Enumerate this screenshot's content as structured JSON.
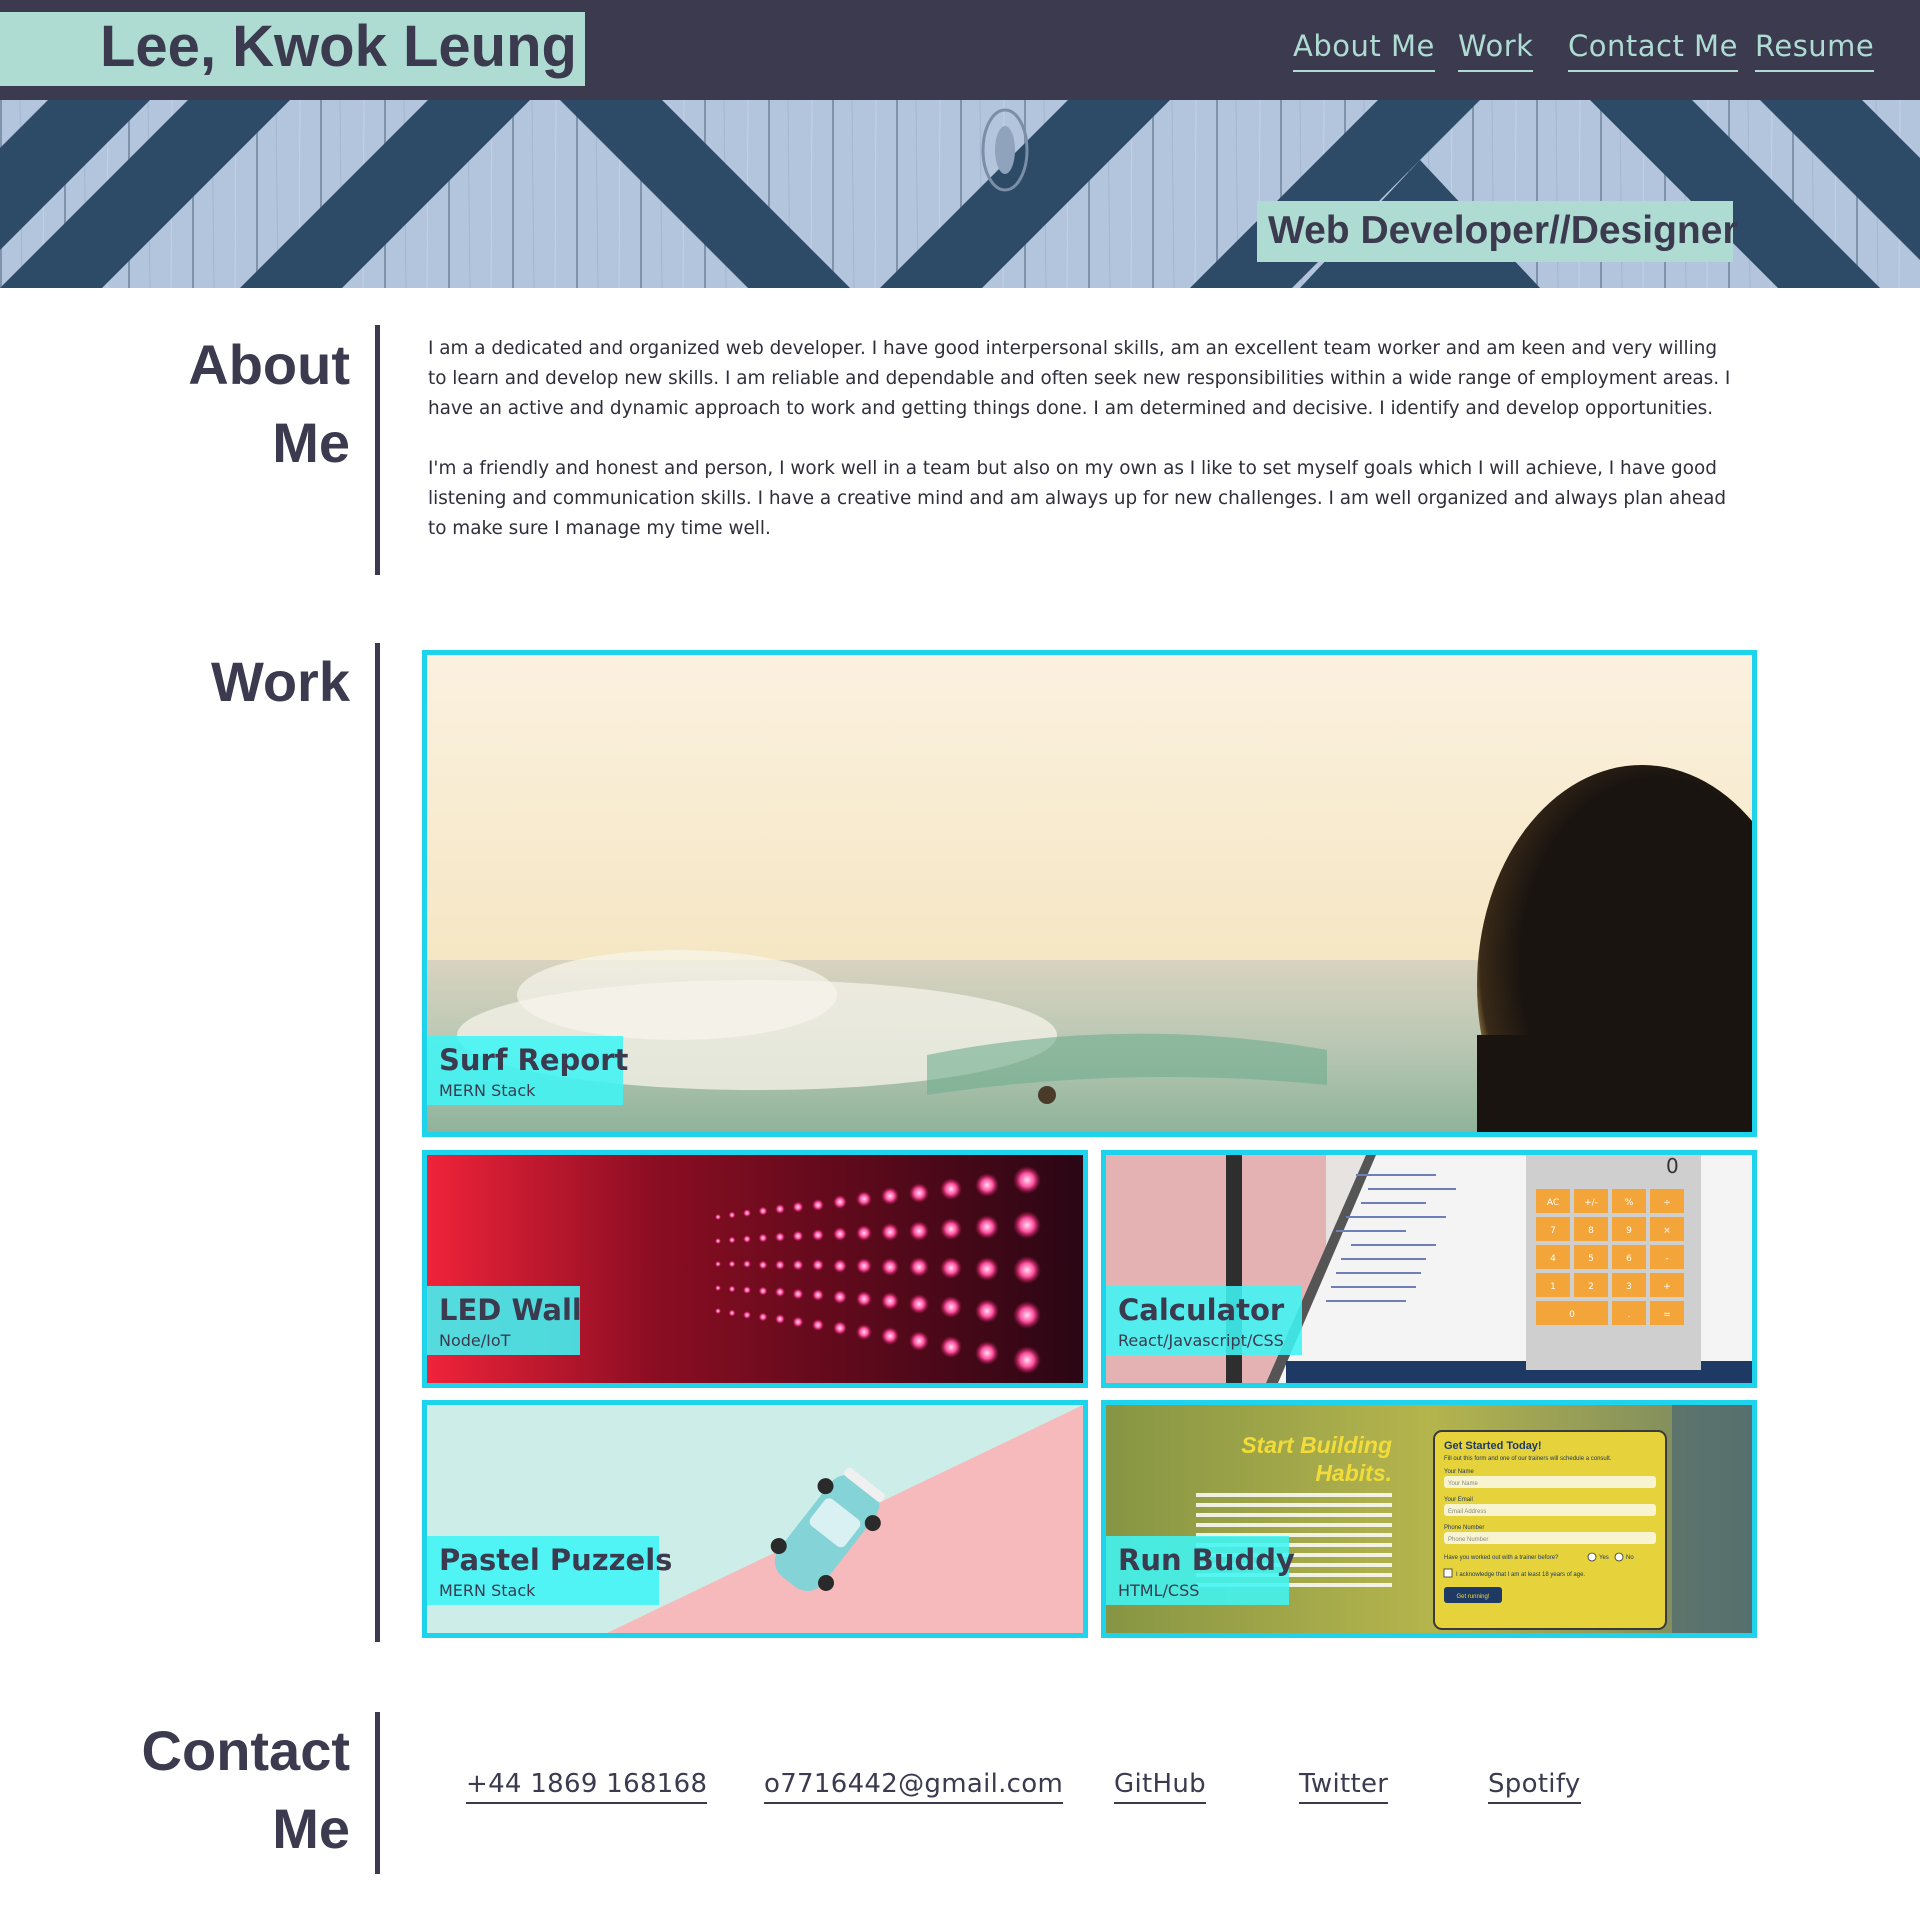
{
  "header": {
    "name": "Lee, Kwok Leung",
    "nav": [
      "About Me",
      "Work",
      "Contact Me",
      "Resume"
    ]
  },
  "hero": {
    "tagline": "Web Developer//Designer"
  },
  "about": {
    "title_line1": "About",
    "title_line2": "Me",
    "paragraph1": "I am a dedicated and organized web developer. I have good interpersonal skills, am an excellent team worker and am keen and very willing to learn and develop new skills. I am reliable and dependable and often seek new responsibilities within a wide range of employment areas. I have an active and dynamic approach to work and getting things done. I am determined and decisive. I identify and develop opportunities.",
    "paragraph2": "I'm a friendly and honest and person, I work well in a team but also on my own as I like to set myself goals which I will achieve, I have good listening and communication skills. I have a creative mind and am always up for new challenges. I am well organized and always plan ahead to make sure I manage my time well."
  },
  "work": {
    "title": "Work",
    "projects": [
      {
        "title": "Surf Report",
        "stack": "MERN Stack"
      },
      {
        "title": "LED Wall",
        "stack": "Node/IoT"
      },
      {
        "title": "Calculator",
        "stack": "React/Javascript/CSS"
      },
      {
        "title": "Pastel Puzzels",
        "stack": "MERN Stack"
      },
      {
        "title": "Run Buddy",
        "stack": "HTML/CSS"
      }
    ],
    "calculator_display": "0",
    "calculator_keys": [
      "AC",
      "+/-",
      "%",
      "÷",
      "7",
      "8",
      "9",
      "×",
      "4",
      "5",
      "6",
      "-",
      "1",
      "2",
      "3",
      "+",
      "0",
      ".",
      "="
    ],
    "run_buddy_screenshot": {
      "headline_line1": "Start Building",
      "headline_line2": "Habits.",
      "form_title": "Get Started Today!",
      "form_intro": "Fill out this form and one of our trainers will schedule a consult.",
      "name_label": "Your Name",
      "name_placeholder": "Your Name",
      "email_label": "Your Email",
      "email_placeholder": "Email Address",
      "phone_label": "Phone Number",
      "phone_placeholder": "Phone Number",
      "question": "Have you worked out with a trainer before?",
      "yes": "Yes",
      "no": "No",
      "acknowledge": "I acknowledge that I am at least 18 years of age.",
      "button": "Get running!"
    }
  },
  "contact": {
    "title_line1": "Contact",
    "title_line2": "Me",
    "links": [
      "+44 1869 168168",
      "o7716442@gmail.com",
      "GitHub",
      "Twitter",
      "Spotify"
    ]
  },
  "colors": {
    "header_bg": "#3b3a4f",
    "accent_mint": "#aedbd2",
    "card_border": "#1ed3ec",
    "label_cyan": "#40f5f5"
  }
}
